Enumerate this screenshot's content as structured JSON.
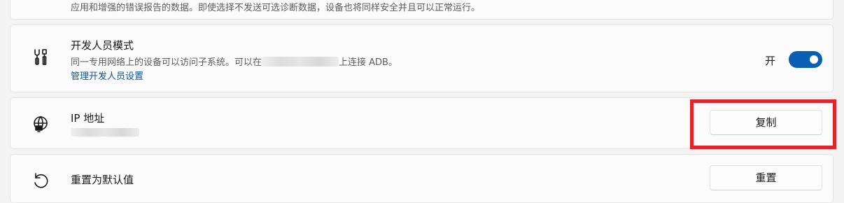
{
  "diagnostics_note": "应用和增强的错误报告的数据。即使选择不发送可选诊断数据，设备也将同样安全并且可以正常运行。",
  "developer_mode": {
    "title": "开发人员模式",
    "description_before": "同一专用网络上的设备可以访问子系统。可以在",
    "description_after": "上连接 ADB。",
    "link": "管理开发人员设置",
    "toggle_state": "开",
    "toggle_on": true,
    "icon": "developer-tools-icon"
  },
  "ip_address": {
    "title": "IP 地址",
    "copy_button": "复制",
    "icon": "globe-network-icon"
  },
  "reset": {
    "title": "重置为默认值",
    "button": "重置",
    "icon": "reset-arrow-icon"
  },
  "colors": {
    "accent": "#0a5fb4",
    "link": "#0a57a6",
    "highlight": "#e0242b"
  }
}
